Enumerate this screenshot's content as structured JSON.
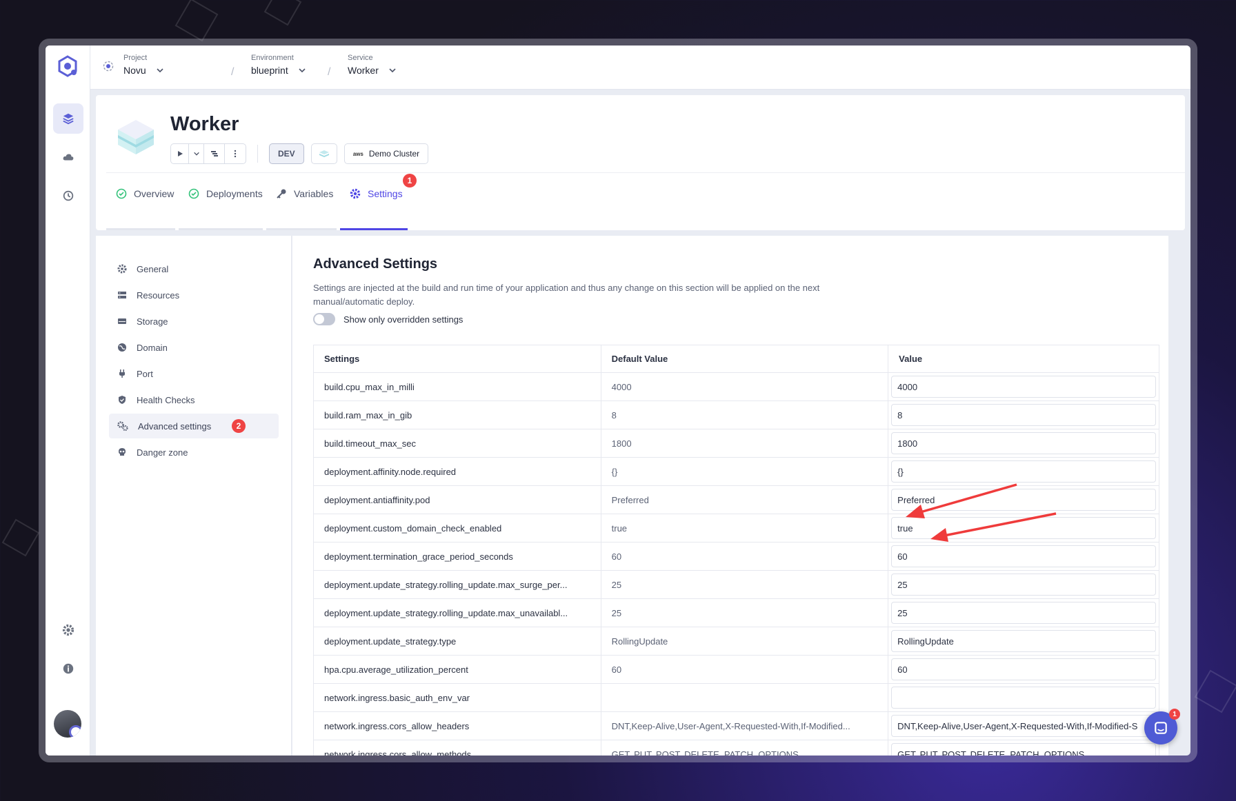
{
  "breadcrumb": {
    "project": {
      "label": "Project",
      "value": "Novu"
    },
    "environment": {
      "label": "Environment",
      "value": "blueprint"
    },
    "service": {
      "label": "Service",
      "value": "Worker"
    },
    "separator": "/"
  },
  "header": {
    "title": "Worker",
    "env_badge": "DEV",
    "cluster_provider": "aws",
    "cluster_label": "Demo Cluster"
  },
  "tabs": [
    {
      "label": "Overview",
      "icon": "check-circle-icon"
    },
    {
      "label": "Deployments",
      "icon": "check-circle-icon"
    },
    {
      "label": "Variables",
      "icon": "key-icon"
    },
    {
      "label": "Settings",
      "icon": "gear-icon",
      "active": true,
      "badge": "1"
    }
  ],
  "sidebar": {
    "items": [
      {
        "label": "General",
        "icon": "gear-icon"
      },
      {
        "label": "Resources",
        "icon": "resources-icon"
      },
      {
        "label": "Storage",
        "icon": "storage-icon"
      },
      {
        "label": "Domain",
        "icon": "globe-icon"
      },
      {
        "label": "Port",
        "icon": "plug-icon"
      },
      {
        "label": "Health Checks",
        "icon": "shield-icon"
      },
      {
        "label": "Advanced settings",
        "icon": "gears-icon",
        "active": true,
        "badge": "2"
      },
      {
        "label": "Danger zone",
        "icon": "skull-icon"
      }
    ]
  },
  "main": {
    "title": "Advanced Settings",
    "description": "Settings are injected at the build and run time of your application and thus any change on this section will be applied on the next manual/automatic deploy.",
    "toggle_label": "Show only overridden settings",
    "toggle_on": false
  },
  "table": {
    "headers": [
      "Settings",
      "Default Value",
      "Value"
    ],
    "rows": [
      {
        "setting": "build.cpu_max_in_milli",
        "default": "4000",
        "value": "4000"
      },
      {
        "setting": "build.ram_max_in_gib",
        "default": "8",
        "value": "8"
      },
      {
        "setting": "build.timeout_max_sec",
        "default": "1800",
        "value": "1800"
      },
      {
        "setting": "deployment.affinity.node.required",
        "default": "{}",
        "value": "{}"
      },
      {
        "setting": "deployment.antiaffinity.pod",
        "default": "Preferred",
        "value": "Preferred"
      },
      {
        "setting": "deployment.custom_domain_check_enabled",
        "default": "true",
        "value": "true"
      },
      {
        "setting": "deployment.termination_grace_period_seconds",
        "default": "60",
        "value": "60"
      },
      {
        "setting": "deployment.update_strategy.rolling_update.max_surge_per...",
        "default": "25",
        "value": "25"
      },
      {
        "setting": "deployment.update_strategy.rolling_update.max_unavailabl...",
        "default": "25",
        "value": "25"
      },
      {
        "setting": "deployment.update_strategy.type",
        "default": "RollingUpdate",
        "value": "RollingUpdate"
      },
      {
        "setting": "hpa.cpu.average_utilization_percent",
        "default": "60",
        "value": "60"
      },
      {
        "setting": "network.ingress.basic_auth_env_var",
        "default": "",
        "value": ""
      },
      {
        "setting": "network.ingress.cors_allow_headers",
        "default": "DNT,Keep-Alive,User-Agent,X-Requested-With,If-Modified...",
        "value": "DNT,Keep-Alive,User-Agent,X-Requested-With,If-Modified-S"
      },
      {
        "setting": "network.ingress.cors_allow_methods",
        "default": "GET, PUT, POST, DELETE, PATCH, OPTIONS",
        "value": "GET, PUT, POST, DELETE, PATCH, OPTIONS"
      }
    ]
  },
  "chat_badge": "1",
  "colors": {
    "accent": "#4f46e5",
    "badge": "#ef4444",
    "annotation_arrow": "#ef3b3b"
  }
}
